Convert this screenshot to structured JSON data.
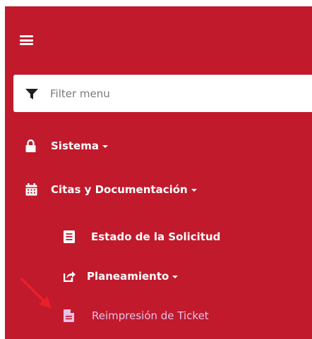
{
  "filter": {
    "placeholder": "Filter menu",
    "value": ""
  },
  "menu": {
    "items": [
      {
        "label": "Sistema",
        "icon": "lock-icon"
      },
      {
        "label": "Citas y Documentación",
        "icon": "calendar-icon"
      }
    ],
    "subitems": [
      {
        "label": "Estado de la Solicitud",
        "icon": "list-icon"
      },
      {
        "label": "Planeamiento",
        "icon": "share-icon"
      },
      {
        "label": "Reimpresión de Ticket",
        "icon": "file-icon"
      }
    ]
  },
  "colors": {
    "sidebar_bg": "#c01a2c",
    "text": "#ffffff",
    "highlight_text": "#e6c1e8",
    "annotation_arrow": "#e8202a"
  }
}
